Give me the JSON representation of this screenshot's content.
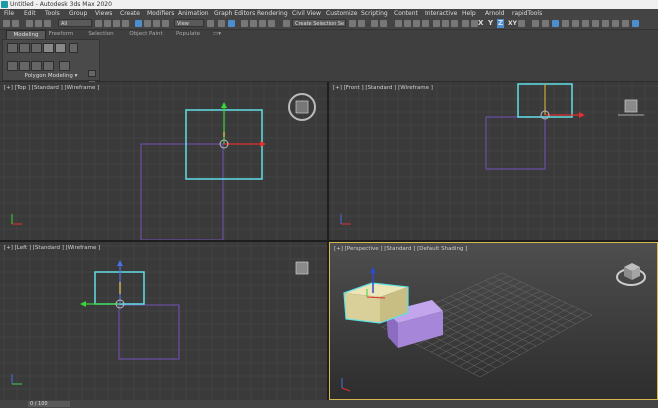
{
  "window": {
    "title": "Untitled - Autodesk 3ds Max 2020"
  },
  "menu": [
    "File",
    "Edit",
    "Tools",
    "Group",
    "Views",
    "Create",
    "Modifiers",
    "Animation",
    "Graph Editors",
    "Rendering",
    "Civil View",
    "Customize",
    "Scripting",
    "Content",
    "Interactive",
    "Help",
    "Arnold",
    "rapidTools"
  ],
  "toolbar": {
    "selection_filter": "All",
    "ref_coord": "View",
    "selection_set": "Create Selection Se",
    "axis_x": "X",
    "axis_y": "Y",
    "axis_z": "Z",
    "axis_xy": "XY"
  },
  "ribbon": {
    "tabs": [
      "Modeling",
      "Freeform",
      "Selection",
      "Object Paint",
      "Populate"
    ],
    "active_tab": "Modeling",
    "panel_label": "Polygon Modeling"
  },
  "viewports": {
    "top": {
      "label": "[+] [Top ] [Standard ] [Wireframe ]"
    },
    "front": {
      "label": "[+] [Front ] [Standard ] [Wireframe ]"
    },
    "left": {
      "label": "[+] [Left ] [Standard ] [Wireframe ]"
    },
    "perspective": {
      "label": "[+] [Perspective ] [Standard ] [Default Shading ]"
    }
  },
  "status": {
    "field": "0 / 100"
  },
  "colors": {
    "grid": "#4a4a4a",
    "viewport_bg": "#3a3a3a",
    "selected_box": "#5fe0e6",
    "purple_box": "#6b4fa3",
    "perspective_box_front": "#d9cf98",
    "perspective_box_purple": "#a586d8",
    "active_border": "#d6b84e"
  }
}
